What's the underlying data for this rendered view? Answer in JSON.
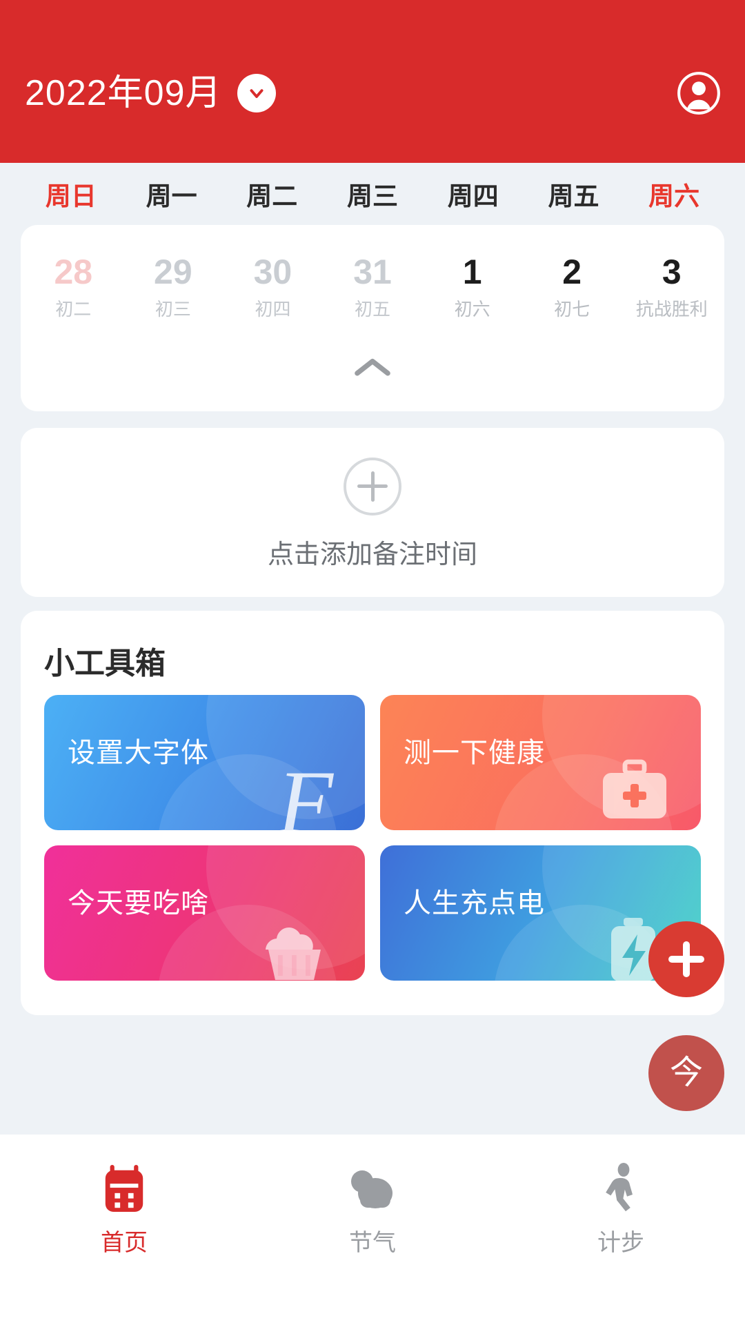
{
  "header": {
    "month_label": "2022年09月",
    "dropdown_icon": "chevron-down-icon",
    "avatar_icon": "user-avatar-icon",
    "bg_color": "#d82b2b"
  },
  "calendar": {
    "weekdays": [
      {
        "label": "周日",
        "highlight": true
      },
      {
        "label": "周一",
        "highlight": false
      },
      {
        "label": "周二",
        "highlight": false
      },
      {
        "label": "周三",
        "highlight": false
      },
      {
        "label": "周四",
        "highlight": false
      },
      {
        "label": "周五",
        "highlight": false
      },
      {
        "label": "周六",
        "highlight": true
      }
    ],
    "days": [
      {
        "num": "28",
        "lunar": "初二",
        "state": "prev-weekend"
      },
      {
        "num": "29",
        "lunar": "初三",
        "state": "prev"
      },
      {
        "num": "30",
        "lunar": "初四",
        "state": "prev"
      },
      {
        "num": "31",
        "lunar": "初五",
        "state": "prev"
      },
      {
        "num": "1",
        "lunar": "初六",
        "state": "current"
      },
      {
        "num": "2",
        "lunar": "初七",
        "state": "current"
      },
      {
        "num": "3",
        "lunar": "抗战胜利",
        "state": "current"
      }
    ],
    "collapse_icon": "chevron-up-icon"
  },
  "note": {
    "add_icon": "plus-circle-icon",
    "text": "点击添加备注时间"
  },
  "toolbox": {
    "title": "小工具箱",
    "cards": [
      {
        "label": "设置大字体",
        "theme": "tc-font",
        "deco": "script-f-icon"
      },
      {
        "label": "测一下健康",
        "theme": "tc-health",
        "deco": "medical-kit-icon"
      },
      {
        "label": "今天要吃啥",
        "theme": "tc-food",
        "deco": "cupcake-icon"
      },
      {
        "label": "人生充点电",
        "theme": "tc-power",
        "deco": "battery-bolt-icon"
      }
    ]
  },
  "fab": {
    "add_label": "+",
    "add_icon": "plus-icon",
    "today_label": "今",
    "add_color": "#d93b32",
    "today_color": "#c1514c"
  },
  "bottom_nav": {
    "items": [
      {
        "label": "首页",
        "icon": "calendar-icon",
        "active": true
      },
      {
        "label": "节气",
        "icon": "cloud-icon",
        "active": false
      },
      {
        "label": "计步",
        "icon": "walking-person-icon",
        "active": false
      }
    ],
    "active_color": "#d82b2b",
    "inactive_color": "#9a9da1"
  }
}
